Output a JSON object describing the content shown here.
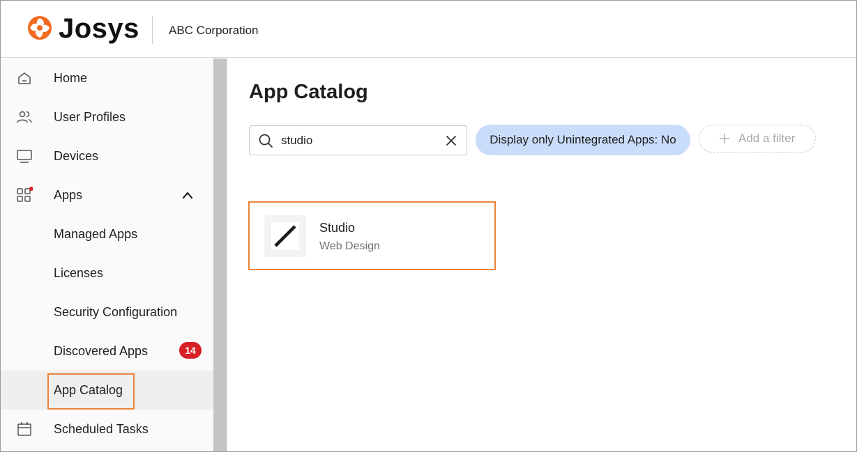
{
  "header": {
    "brand": "Josys",
    "organization": "ABC Corporation",
    "logo_icon": "josys-logo-icon",
    "brand_color": "#f26b21"
  },
  "sidebar": {
    "items": [
      {
        "label": "Home",
        "icon": "home-icon"
      },
      {
        "label": "User Profiles",
        "icon": "users-icon"
      },
      {
        "label": "Devices",
        "icon": "monitor-icon"
      },
      {
        "label": "Apps",
        "icon": "apps-grid-icon",
        "expanded": true,
        "has_notification_dot": true
      },
      {
        "label": "Managed Apps"
      },
      {
        "label": "Licenses"
      },
      {
        "label": "Security Configuration"
      },
      {
        "label": "Discovered Apps",
        "badge": "14"
      },
      {
        "label": "App Catalog",
        "active": true
      },
      {
        "label": "Scheduled Tasks",
        "icon": "calendar-icon"
      }
    ]
  },
  "main": {
    "title": "App Catalog",
    "search": {
      "value": "studio",
      "placeholder": ""
    },
    "filter_chip": "Display only Unintegrated Apps: No",
    "add_filter_label": "Add a filter",
    "apps": [
      {
        "name": "Studio",
        "category": "Web Design"
      }
    ]
  },
  "colors": {
    "accent_highlight": "#e8843a",
    "filter_chip_bg": "#c9dcfa",
    "badge_red": "#d71f26"
  }
}
